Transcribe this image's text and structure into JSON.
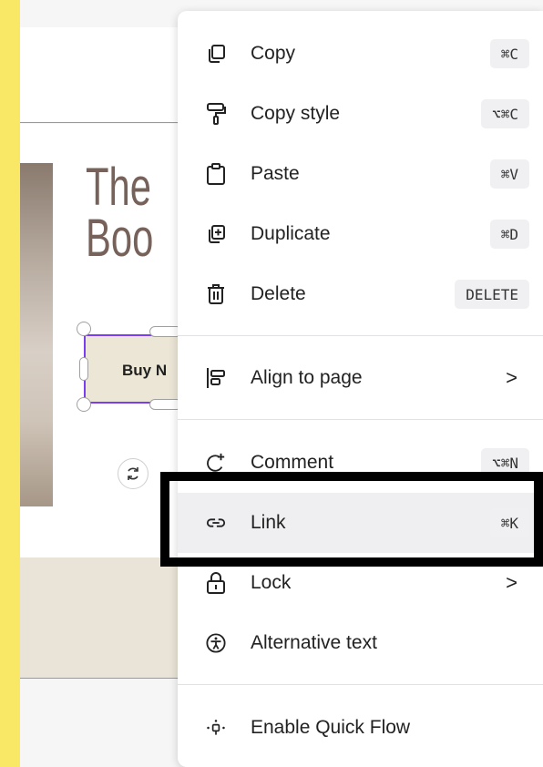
{
  "canvas": {
    "heading_line1": "The",
    "heading_line2": "Boo",
    "selected_button_label": "Buy N",
    "rotate_icon": "rotate-icon"
  },
  "context_menu": {
    "items": [
      {
        "label": "Copy",
        "shortcut": "⌘C",
        "icon": "copy-icon"
      },
      {
        "label": "Copy style",
        "shortcut": "⌥⌘C",
        "icon": "paint-roller-icon"
      },
      {
        "label": "Paste",
        "shortcut": "⌘V",
        "icon": "clipboard-icon"
      },
      {
        "label": "Duplicate",
        "shortcut": "⌘D",
        "icon": "duplicate-icon"
      },
      {
        "label": "Delete",
        "shortcut": "DELETE",
        "icon": "trash-icon"
      },
      {
        "label": "Align to page",
        "shortcut": "",
        "icon": "align-icon",
        "submenu": ">"
      },
      {
        "label": "Comment",
        "shortcut": "⌥⌘N",
        "icon": "comment-add-icon"
      },
      {
        "label": "Link",
        "shortcut": "⌘K",
        "icon": "link-icon",
        "highlighted": true
      },
      {
        "label": "Lock",
        "shortcut": "",
        "icon": "lock-icon",
        "submenu": ">"
      },
      {
        "label": "Alternative text",
        "shortcut": "",
        "icon": "accessibility-icon"
      },
      {
        "label": "Enable Quick Flow",
        "shortcut": "",
        "icon": "quick-flow-icon"
      }
    ]
  },
  "colors": {
    "background_yellow": "#f9e866",
    "selection_purple": "#7a3df0",
    "heading_brown": "#76625a",
    "button_beige": "#ebe6d6"
  }
}
